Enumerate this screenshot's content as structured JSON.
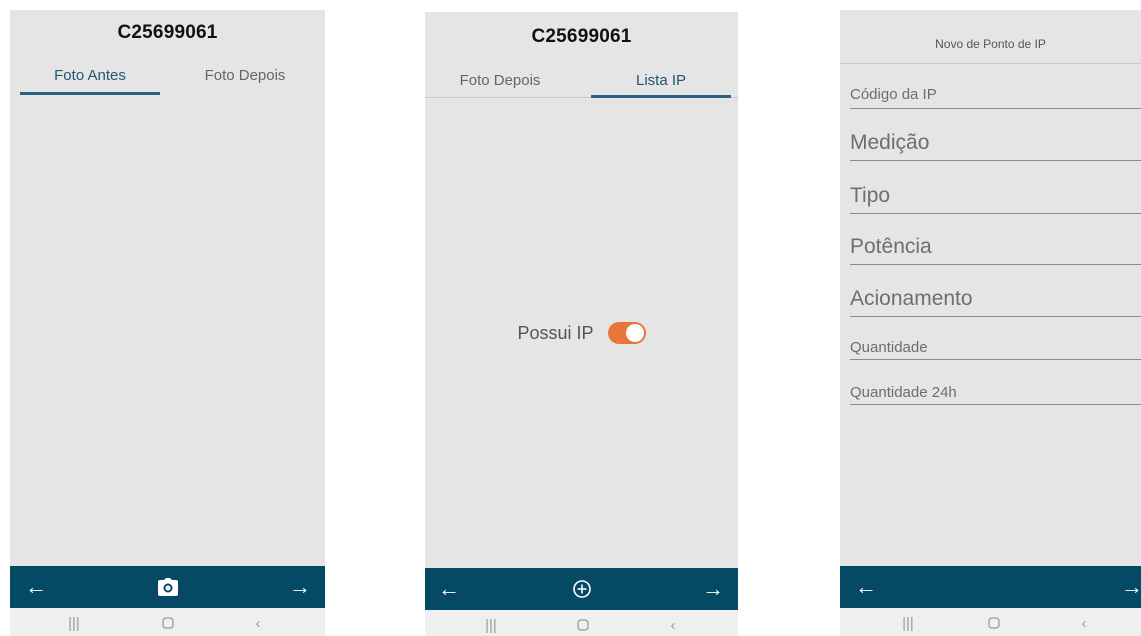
{
  "screen1": {
    "title": "C25699061",
    "tabs": [
      "Foto Antes",
      "Foto Depois"
    ],
    "active_tab": "Foto Antes",
    "bottom_bar": {
      "left_icon": "arrow-left-icon",
      "center_icon": "camera-icon",
      "right_icon": "arrow-right-icon"
    }
  },
  "screen2": {
    "title": "C25699061",
    "tabs": [
      "Foto Depois",
      "Lista IP"
    ],
    "active_tab": "Lista IP",
    "toggle_label": "Possui IP",
    "toggle_on": true,
    "bottom_bar": {
      "left_icon": "arrow-left-icon",
      "center_icon": "plus-circle-icon",
      "right_icon": "arrow-right-icon"
    }
  },
  "screen3": {
    "title": "Novo de Ponto de IP",
    "fields": {
      "codigo": "Código da IP",
      "medicao": "Medição",
      "tipo": "Tipo",
      "potencia": "Potência",
      "acionamento": "Acionamento",
      "quantidade": "Quantidade",
      "quantidade24h": "Quantidade 24h"
    },
    "bottom_bar": {
      "left_icon": "arrow-left-icon",
      "right_icon": "arrow-right-icon"
    }
  },
  "system_nav_icons": [
    "recent-apps-icon",
    "home-icon",
    "back-icon"
  ],
  "colors": {
    "accent_teal": "#044a64",
    "tab_active": "#1f5672",
    "toggle_orange": "#e8763a",
    "background": "#e5e5e5"
  }
}
